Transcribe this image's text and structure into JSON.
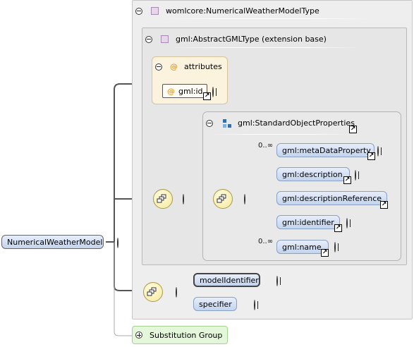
{
  "outer_type": {
    "label": "womlcore:NumericalWeatherModelType"
  },
  "base_type": {
    "label": "gml:AbstractGMLType (extension base)"
  },
  "attributes_group": {
    "label": "attributes",
    "items": [
      {
        "label": "gml:id"
      }
    ]
  },
  "std_group": {
    "label": "gml:StandardObjectProperties"
  },
  "std_elements": [
    {
      "label": "gml:metaDataProperty",
      "cardinality": "0..∞"
    },
    {
      "label": "gml:description",
      "cardinality": ""
    },
    {
      "label": "gml:descriptionReference",
      "cardinality": ""
    },
    {
      "label": "gml:identifier",
      "cardinality": ""
    },
    {
      "label": "gml:name",
      "cardinality": "0..∞"
    }
  ],
  "root_element": {
    "label": "NumericalWeatherModel"
  },
  "model_elements": [
    {
      "label": "modelIdentifier"
    },
    {
      "label": "specifier"
    }
  ],
  "substitution": {
    "label": "Substitution Group"
  },
  "icons": {
    "collapse": "minus-circle-icon",
    "expand": "plus-circle-icon",
    "type": "complex-type-icon",
    "attribute": "at-sign-icon",
    "group": "attribute-group-icon",
    "sequence": "sequence-compositor-icon",
    "link": "link-arrow-icon"
  },
  "colors": {
    "element_fill": "#c3d4ee",
    "element_border": "#8aa0c4",
    "attribute_fill": "#fbf3de",
    "compositor": "#f6e99a",
    "substitution_fill": "#e4f7db",
    "connector": "#555555"
  }
}
